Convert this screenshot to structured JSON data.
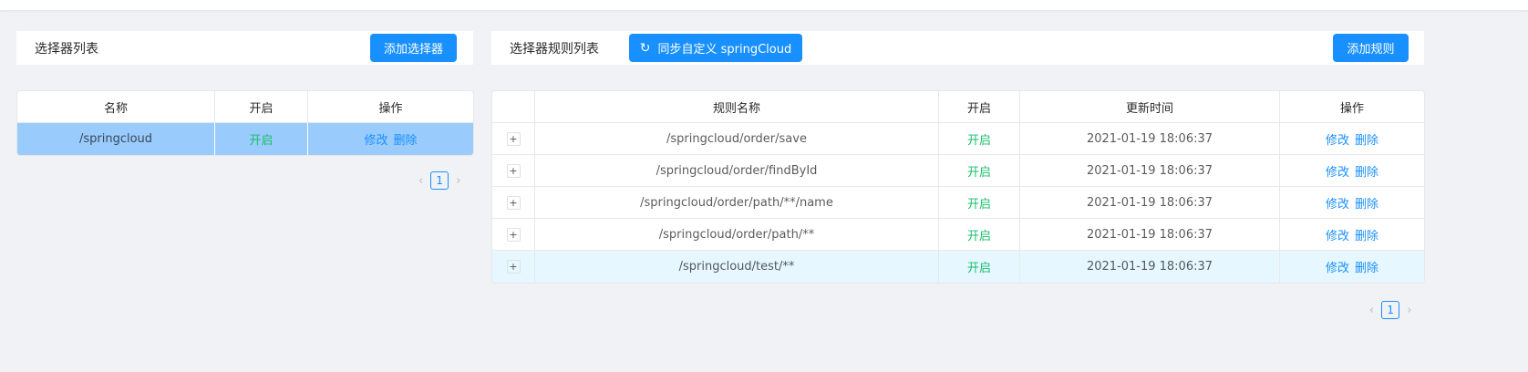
{
  "left": {
    "title": "选择器列表",
    "add_button": "添加选择器",
    "columns": [
      "名称",
      "开启",
      "操作"
    ],
    "rows": [
      {
        "name": "/springcloud",
        "enabled": "开启",
        "edit": "修改",
        "delete": "删除"
      }
    ],
    "page": "1"
  },
  "right": {
    "title": "选择器规则列表",
    "sync_button": "同步自定义 springCloud",
    "add_button": "添加规则",
    "columns": [
      "",
      "规则名称",
      "开启",
      "更新时间",
      "操作"
    ],
    "rows": [
      {
        "name": "/springcloud/order/save",
        "enabled": "开启",
        "time": "2021-01-19 18:06:37",
        "edit": "修改",
        "delete": "删除"
      },
      {
        "name": "/springcloud/order/findById",
        "enabled": "开启",
        "time": "2021-01-19 18:06:37",
        "edit": "修改",
        "delete": "删除"
      },
      {
        "name": "/springcloud/order/path/**/name",
        "enabled": "开启",
        "time": "2021-01-19 18:06:37",
        "edit": "修改",
        "delete": "删除"
      },
      {
        "name": "/springcloud/order/path/**",
        "enabled": "开启",
        "time": "2021-01-19 18:06:37",
        "edit": "修改",
        "delete": "删除"
      },
      {
        "name": "/springcloud/test/**",
        "enabled": "开启",
        "time": "2021-01-19 18:06:37",
        "edit": "修改",
        "delete": "删除"
      }
    ],
    "page": "1"
  },
  "expand_symbol": "+",
  "prev": "‹",
  "next": "›"
}
